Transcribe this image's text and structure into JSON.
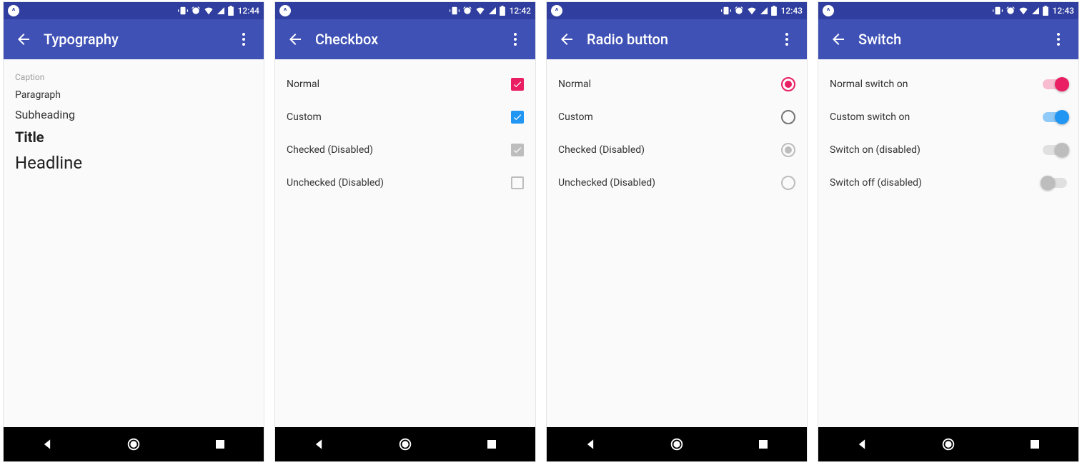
{
  "colors": {
    "primary": "#3f51b5",
    "primaryDark": "#303f9f",
    "accentPink": "#e91e63",
    "accentBlue": "#2196f3",
    "disabledGrey": "#bdbdbd",
    "outlineGrey": "#757575"
  },
  "screens": [
    {
      "time": "12:44",
      "title": "Typography",
      "type": "typography",
      "items": [
        {
          "name": "caption",
          "label": "Caption"
        },
        {
          "name": "paragraph",
          "label": "Paragraph"
        },
        {
          "name": "subhead",
          "label": "Subheading"
        },
        {
          "name": "title",
          "label": "Title"
        },
        {
          "name": "headline",
          "label": "Headline"
        }
      ]
    },
    {
      "time": "12:42",
      "title": "Checkbox",
      "type": "checkbox",
      "items": [
        {
          "label": "Normal",
          "checked": true,
          "disabled": false,
          "color": "#e91e63"
        },
        {
          "label": "Custom",
          "checked": true,
          "disabled": false,
          "color": "#2196f3"
        },
        {
          "label": "Checked (Disabled)",
          "checked": true,
          "disabled": true,
          "color": "#bdbdbd"
        },
        {
          "label": "Unchecked (Disabled)",
          "checked": false,
          "disabled": true,
          "color": "#bdbdbd"
        }
      ]
    },
    {
      "time": "12:43",
      "title": "Radio button",
      "type": "radio",
      "items": [
        {
          "label": "Normal",
          "checked": true,
          "disabled": false,
          "color": "#e91e63"
        },
        {
          "label": "Custom",
          "checked": false,
          "disabled": false,
          "color": "#757575"
        },
        {
          "label": "Checked (Disabled)",
          "checked": true,
          "disabled": true,
          "color": "#bdbdbd"
        },
        {
          "label": "Unchecked (Disabled)",
          "checked": false,
          "disabled": true,
          "color": "#bdbdbd"
        }
      ]
    },
    {
      "time": "12:43",
      "title": "Switch",
      "type": "switch",
      "items": [
        {
          "label": "Normal switch on",
          "on": true,
          "disabled": false,
          "trackColor": "#f8bbd0",
          "thumbColor": "#e91e63"
        },
        {
          "label": "Custom switch on",
          "on": true,
          "disabled": false,
          "trackColor": "#90caf9",
          "thumbColor": "#2196f3"
        },
        {
          "label": "Switch on (disabled)",
          "on": true,
          "disabled": true,
          "trackColor": "#e0e0e0",
          "thumbColor": "#bdbdbd"
        },
        {
          "label": "Switch off (disabled)",
          "on": false,
          "disabled": true,
          "trackColor": "#e0e0e0",
          "thumbColor": "#bdbdbd"
        }
      ]
    }
  ]
}
